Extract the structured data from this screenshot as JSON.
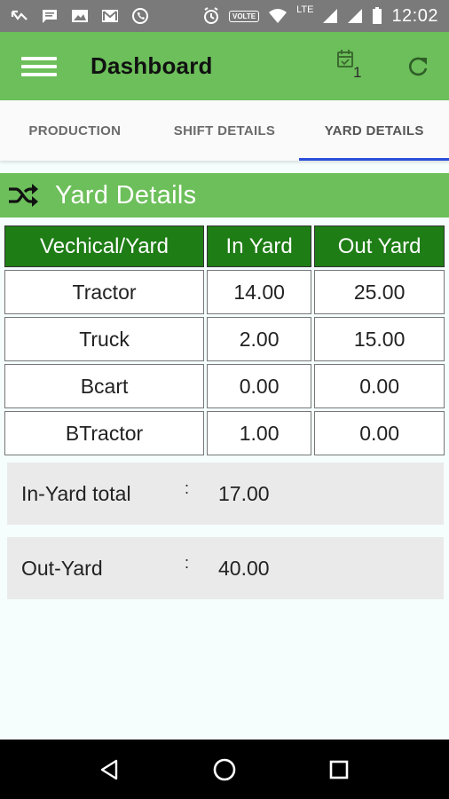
{
  "status_bar": {
    "volte": "VOLTE",
    "lte": "LTE",
    "time": "12:02"
  },
  "app_bar": {
    "title": "Dashboard",
    "notification_count": "1"
  },
  "tabs": [
    {
      "label": "PRODUCTION",
      "active": false
    },
    {
      "label": "SHIFT DETAILS",
      "active": false
    },
    {
      "label": "YARD DETAILS",
      "active": true
    }
  ],
  "section": {
    "title": "Yard Details"
  },
  "table": {
    "headers": [
      "Vechical/Yard",
      "In Yard",
      "Out Yard"
    ],
    "rows": [
      [
        "Tractor",
        "14.00",
        "25.00"
      ],
      [
        "Truck",
        "2.00",
        "15.00"
      ],
      [
        "Bcart",
        "0.00",
        "0.00"
      ],
      [
        "BTractor",
        "1.00",
        "0.00"
      ]
    ]
  },
  "totals": {
    "in_yard_label": "In-Yard total",
    "in_yard_value": "17.00",
    "out_yard_label": "Out-Yard",
    "out_yard_value": "40.00",
    "separator": ":"
  },
  "colors": {
    "app_bar": "#6cbf5a",
    "table_header": "#1e7d15",
    "tab_indicator": "#2b4fd9"
  }
}
